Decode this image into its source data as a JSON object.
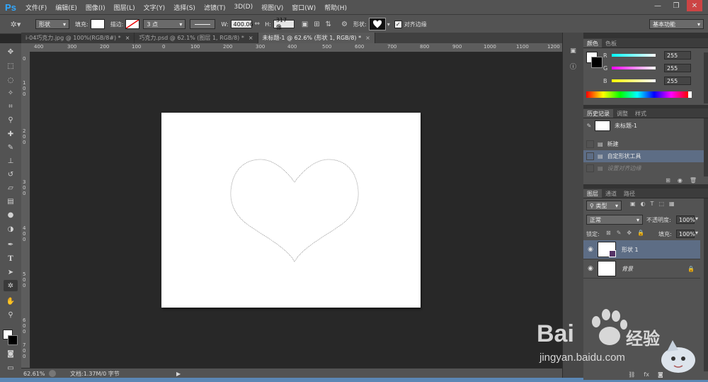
{
  "app": {
    "logo": "Ps"
  },
  "menu": [
    "文件(F)",
    "编辑(E)",
    "图像(I)",
    "图层(L)",
    "文字(Y)",
    "选择(S)",
    "滤镜(T)",
    "3D(D)",
    "视图(V)",
    "窗口(W)",
    "帮助(H)"
  ],
  "options": {
    "mode_value": "形状",
    "fill_label": "填充:",
    "stroke_label": "描边:",
    "stroke_width": "3 点",
    "w_label": "W:",
    "w_value": "400.06",
    "h_label": "H:",
    "h_value": "317 像",
    "shape_label": "形状:",
    "align_edges_label": "对齐边缘",
    "workspace": "基本功能"
  },
  "tabs": [
    {
      "label": "i-04巧克力.jpg @ 100%(RGB/8#) *",
      "active": false
    },
    {
      "label": "巧克力.psd @ 62.1% (图层 1, RGB/8) *",
      "active": false
    },
    {
      "label": "未标题-1 @ 62.6% (形状 1, RGB/8) *",
      "active": true
    }
  ],
  "ruler": {
    "h_ticks": [
      "400",
      "300",
      "200",
      "100",
      "0",
      "100",
      "200",
      "300",
      "400",
      "500",
      "600",
      "700",
      "800",
      "900",
      "1000",
      "1100",
      "1200"
    ],
    "v_ticks": [
      "0",
      "1 0 0",
      "2 0 0",
      "3 0 0",
      "4 0 0",
      "5 0 0",
      "6 0 0",
      "7 0 0"
    ]
  },
  "status": {
    "zoom": "62.61%",
    "doc": "文档:1.37M/0 字节"
  },
  "color_panel": {
    "tabs": [
      "颜色",
      "色板"
    ],
    "channels": [
      {
        "name": "R",
        "value": "255",
        "color": "#ff3b3b"
      },
      {
        "name": "G",
        "value": "255",
        "color": "#3bff3b"
      },
      {
        "name": "B",
        "value": "255",
        "color": "#3b6bff"
      }
    ]
  },
  "history_panel": {
    "tabs": [
      "历史记录",
      "调整",
      "样式"
    ],
    "snapshot": "未标题-1",
    "items": [
      "新建",
      "自定形状工具",
      "设置对齐边缘"
    ]
  },
  "layers_panel": {
    "tabs": [
      "图层",
      "通道",
      "路径"
    ],
    "filter": "类型",
    "blend": "正常",
    "opacity_label": "不透明度:",
    "opacity": "100%",
    "lock_label": "锁定:",
    "fill_label": "填充:",
    "fill": "100%",
    "layers": [
      {
        "name": "形状 1",
        "selected": true
      },
      {
        "name": "背景",
        "selected": false,
        "locked": true
      }
    ]
  },
  "watermark": {
    "brand": "Bai",
    "brand2": "经验",
    "url": "jingyan.baidu.com"
  }
}
